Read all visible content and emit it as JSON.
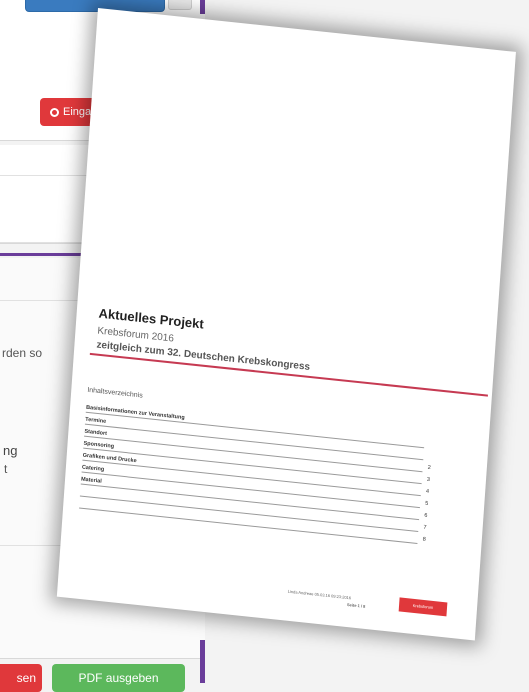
{
  "background_ui": {
    "input_button_label": "Eingabe",
    "fragment_1": "rden so",
    "fragment_2": "ng",
    "fragment_3": "t",
    "bottom_button_red_label": "sen",
    "bottom_button_green_label": "PDF ausgeben"
  },
  "document": {
    "title": "Aktuelles Projekt",
    "subtitle": "Krebsforum 2016",
    "subtitle2": "zeitgleich zum 32. Deutschen Krebskongress",
    "toc_heading": "Inhaltsverzeichnis",
    "toc": [
      {
        "label": "Basisinformationen zur Veranstaltung",
        "page": ""
      },
      {
        "label": "Termine",
        "page": ""
      },
      {
        "label": "Standort",
        "page": "2"
      },
      {
        "label": "Sponsoring",
        "page": "3"
      },
      {
        "label": "Grafiken und Drucke",
        "page": "4"
      },
      {
        "label": "Catering",
        "page": "5"
      },
      {
        "label": "Material",
        "page": "6"
      },
      {
        "label": "",
        "page": "7"
      },
      {
        "label": "",
        "page": "8"
      }
    ],
    "footer_left": "Linda Andreae 05.03.16 09:23:2016",
    "footer_right": "Seite 1 / 8",
    "stamp_label": "Krebsforum"
  },
  "colors": {
    "purple": "#6a3d9a",
    "red": "#e0383b",
    "green": "#5cb85c",
    "blue": "#3a7bbf",
    "accent_rule": "#c63a52"
  }
}
